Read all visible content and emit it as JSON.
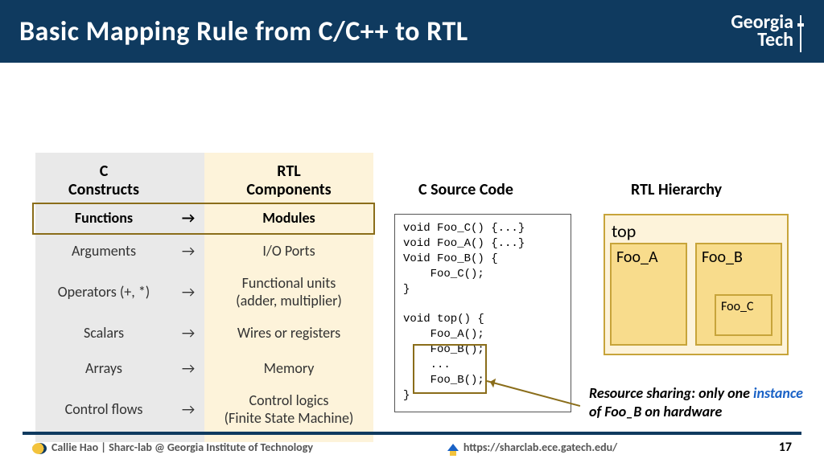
{
  "header": {
    "title": "Basic Mapping Rule from C/C++ to RTL",
    "logo_line1": "Georgia",
    "logo_line2": "Tech"
  },
  "table": {
    "head_c": "C\nConstructs",
    "head_rtl": "RTL\nComponents",
    "arrow": "→",
    "rows": [
      {
        "c": "Functions",
        "rtl": "Modules"
      },
      {
        "c": "Arguments",
        "rtl": "I/O Ports"
      },
      {
        "c": "Operators (+, *)",
        "rtl": "Functional units\n(adder, multiplier)"
      },
      {
        "c": "Scalars",
        "rtl": "Wires or registers"
      },
      {
        "c": "Arrays",
        "rtl": "Memory"
      },
      {
        "c": "Control flows",
        "rtl": "Control logics\n(Finite State Machine)"
      }
    ]
  },
  "src": {
    "title": "C Source Code",
    "l1": "void Foo_C() {...}",
    "l2": "void Foo_A() {...}",
    "l3": "Void Foo_B() {",
    "l4": "    Foo_C();",
    "l5": "}",
    "l6": "",
    "l7": "void top() {",
    "l8": "    Foo_A();",
    "l9": "    Foo_B();",
    "l10": "    ...",
    "l11": "    Foo_B();",
    "l12": "}"
  },
  "hier": {
    "title": "RTL Hierarchy",
    "top": "top",
    "a": "Foo_A",
    "b": "Foo_B",
    "c": "Foo_C"
  },
  "caption": {
    "pre": "Resource sharing: only one ",
    "inst": "instance",
    "post": " of Foo_B on hardware"
  },
  "footer": {
    "left": "Callie Hao | Sharc-lab @ Georgia Institute of Technology",
    "center": "https://sharclab.ece.gatech.edu/",
    "page": "17"
  }
}
